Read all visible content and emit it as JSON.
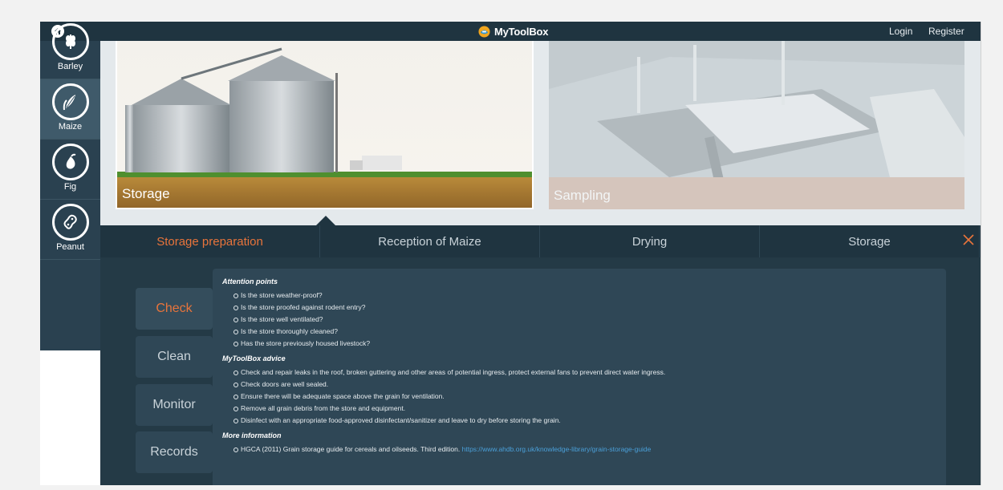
{
  "header": {
    "brand": "MyToolBox",
    "login": "Login",
    "register": "Register"
  },
  "sidebar": {
    "items": [
      {
        "label": "Barley",
        "icon": "barley-icon"
      },
      {
        "label": "Maize",
        "icon": "maize-icon",
        "active": true
      },
      {
        "label": "Fig",
        "icon": "fig-icon"
      },
      {
        "label": "Peanut",
        "icon": "peanut-icon"
      }
    ]
  },
  "hero": {
    "cards": [
      {
        "label": "Storage",
        "active": true
      },
      {
        "label": "Sampling",
        "active": false
      }
    ]
  },
  "tabs": [
    {
      "label": "Storage preparation",
      "active": true
    },
    {
      "label": "Reception of Maize",
      "active": false
    },
    {
      "label": "Drying",
      "active": false
    },
    {
      "label": "Storage",
      "active": false
    }
  ],
  "subnav": [
    {
      "label": "Check",
      "active": true
    },
    {
      "label": "Clean",
      "active": false
    },
    {
      "label": "Monitor",
      "active": false
    },
    {
      "label": "Records",
      "active": false
    }
  ],
  "panel": {
    "attention_title": "Attention points",
    "attention_items": [
      "Is the store weather-proof?",
      "Is the store proofed against rodent entry?",
      "Is the store well ventilated?",
      "Is the store thoroughly cleaned?",
      "Has the store previously housed livestock?"
    ],
    "advice_title": "MyToolBox advice",
    "advice_items": [
      "Check and repair leaks in the roof, broken guttering and other areas of potential ingress, protect external fans to prevent direct water ingress.",
      "Check doors are well sealed.",
      "Ensure there will be adequate space above the grain for ventilation.",
      "Remove all grain debris from the store and equipment.",
      "Disinfect with an appropriate food-approved disinfectant/sanitizer and leave to dry before storing the grain."
    ],
    "more_title": "More information",
    "more_text": "HGCA (2011) Grain storage guide for cereals and oilseeds. Third edition.",
    "more_link": "https://www.ahdb.org.uk/knowledge-library/grain-storage-guide"
  },
  "colors": {
    "accent": "#e8743b",
    "dark": "#1f3440",
    "panel": "#2f4756",
    "link": "#4a9fd8"
  }
}
